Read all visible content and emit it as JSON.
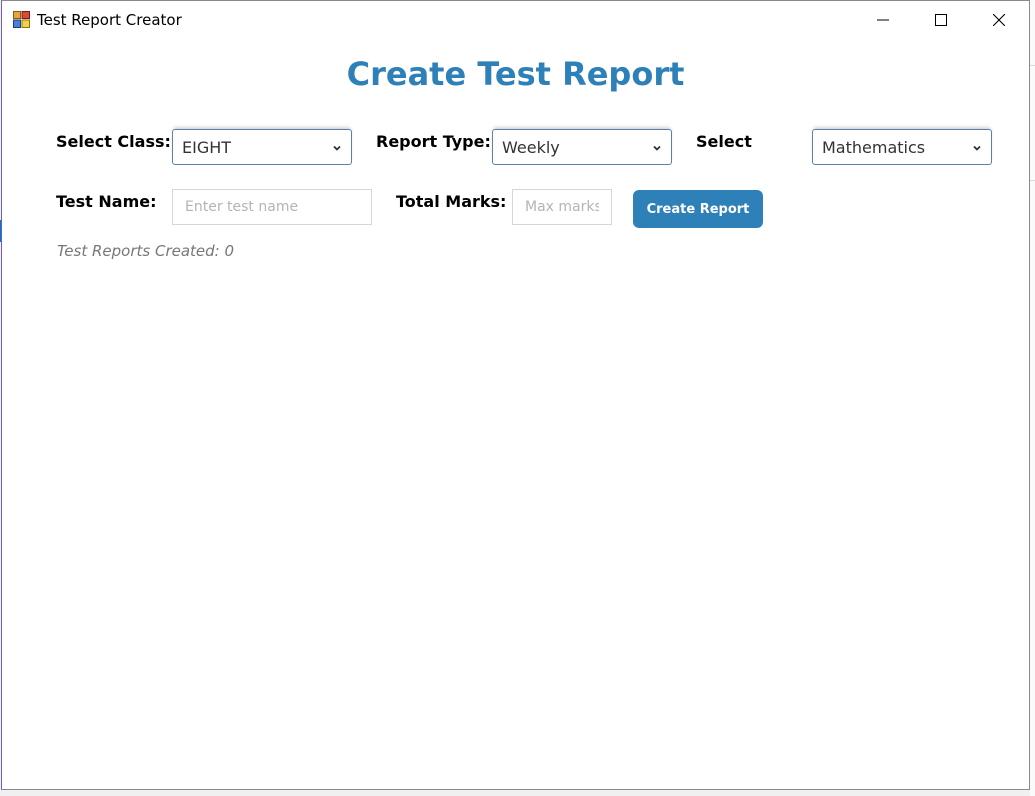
{
  "window": {
    "title": "Test Report Creator"
  },
  "form": {
    "heading": "Create Test Report",
    "class_label": "Select Class:",
    "class_value": "EIGHT",
    "report_type_label": "Report Type:",
    "report_type_value": "Weekly",
    "subject_label": "Select",
    "subject_value": "Mathematics",
    "test_name_label": "Test Name:",
    "test_name_placeholder": "Enter test name",
    "total_marks_label": "Total Marks:",
    "total_marks_placeholder": "Max marks",
    "create_button_label": "Create Report",
    "status_text": "Test Reports Created: 0"
  },
  "colors": {
    "accent": "#2e80b9",
    "status_text": "#777777"
  },
  "icons": {
    "app": "app-icon",
    "minimize": "minimize-icon",
    "maximize": "maximize-icon",
    "close": "close-icon",
    "dropdown": "chevron-down-icon"
  }
}
